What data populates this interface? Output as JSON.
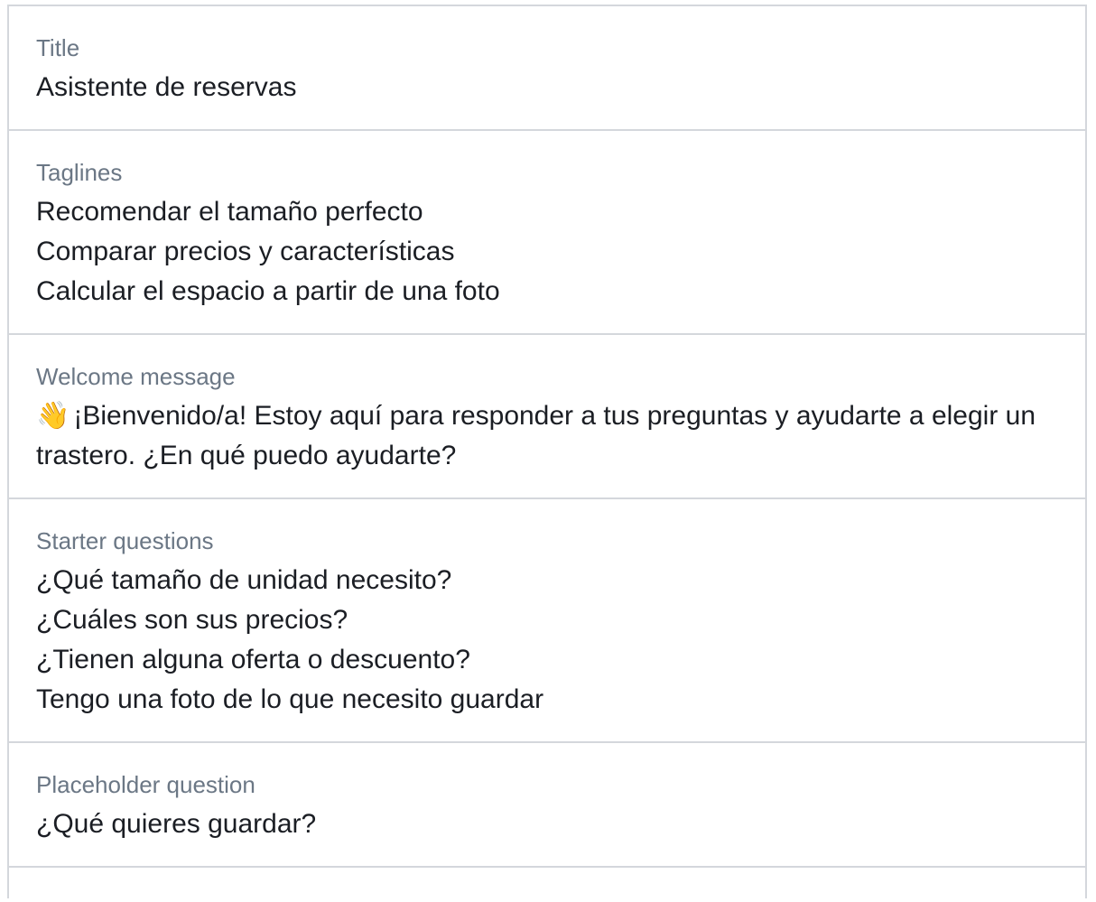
{
  "fields": {
    "title": {
      "label": "Title",
      "value": "Asistente de reservas"
    },
    "taglines": {
      "label": "Taglines",
      "items": [
        "Recomendar el tamaño perfecto",
        "Comparar precios y características",
        "Calcular el espacio a partir de una foto"
      ]
    },
    "welcome": {
      "label": "Welcome message",
      "emoji": "👋",
      "text": "¡Bienvenido/a! Estoy aquí para responder a tus preguntas y ayudarte a elegir un trastero. ¿En qué puedo ayudarte?"
    },
    "starter": {
      "label": "Starter questions",
      "items": [
        "¿Qué tamaño de unidad necesito?",
        "¿Cuáles son sus precios?",
        "¿Tienen alguna oferta o descuento?",
        "Tengo una foto de lo que necesito guardar"
      ]
    },
    "placeholder": {
      "label": "Placeholder question",
      "value": "¿Qué quieres guardar?"
    }
  }
}
